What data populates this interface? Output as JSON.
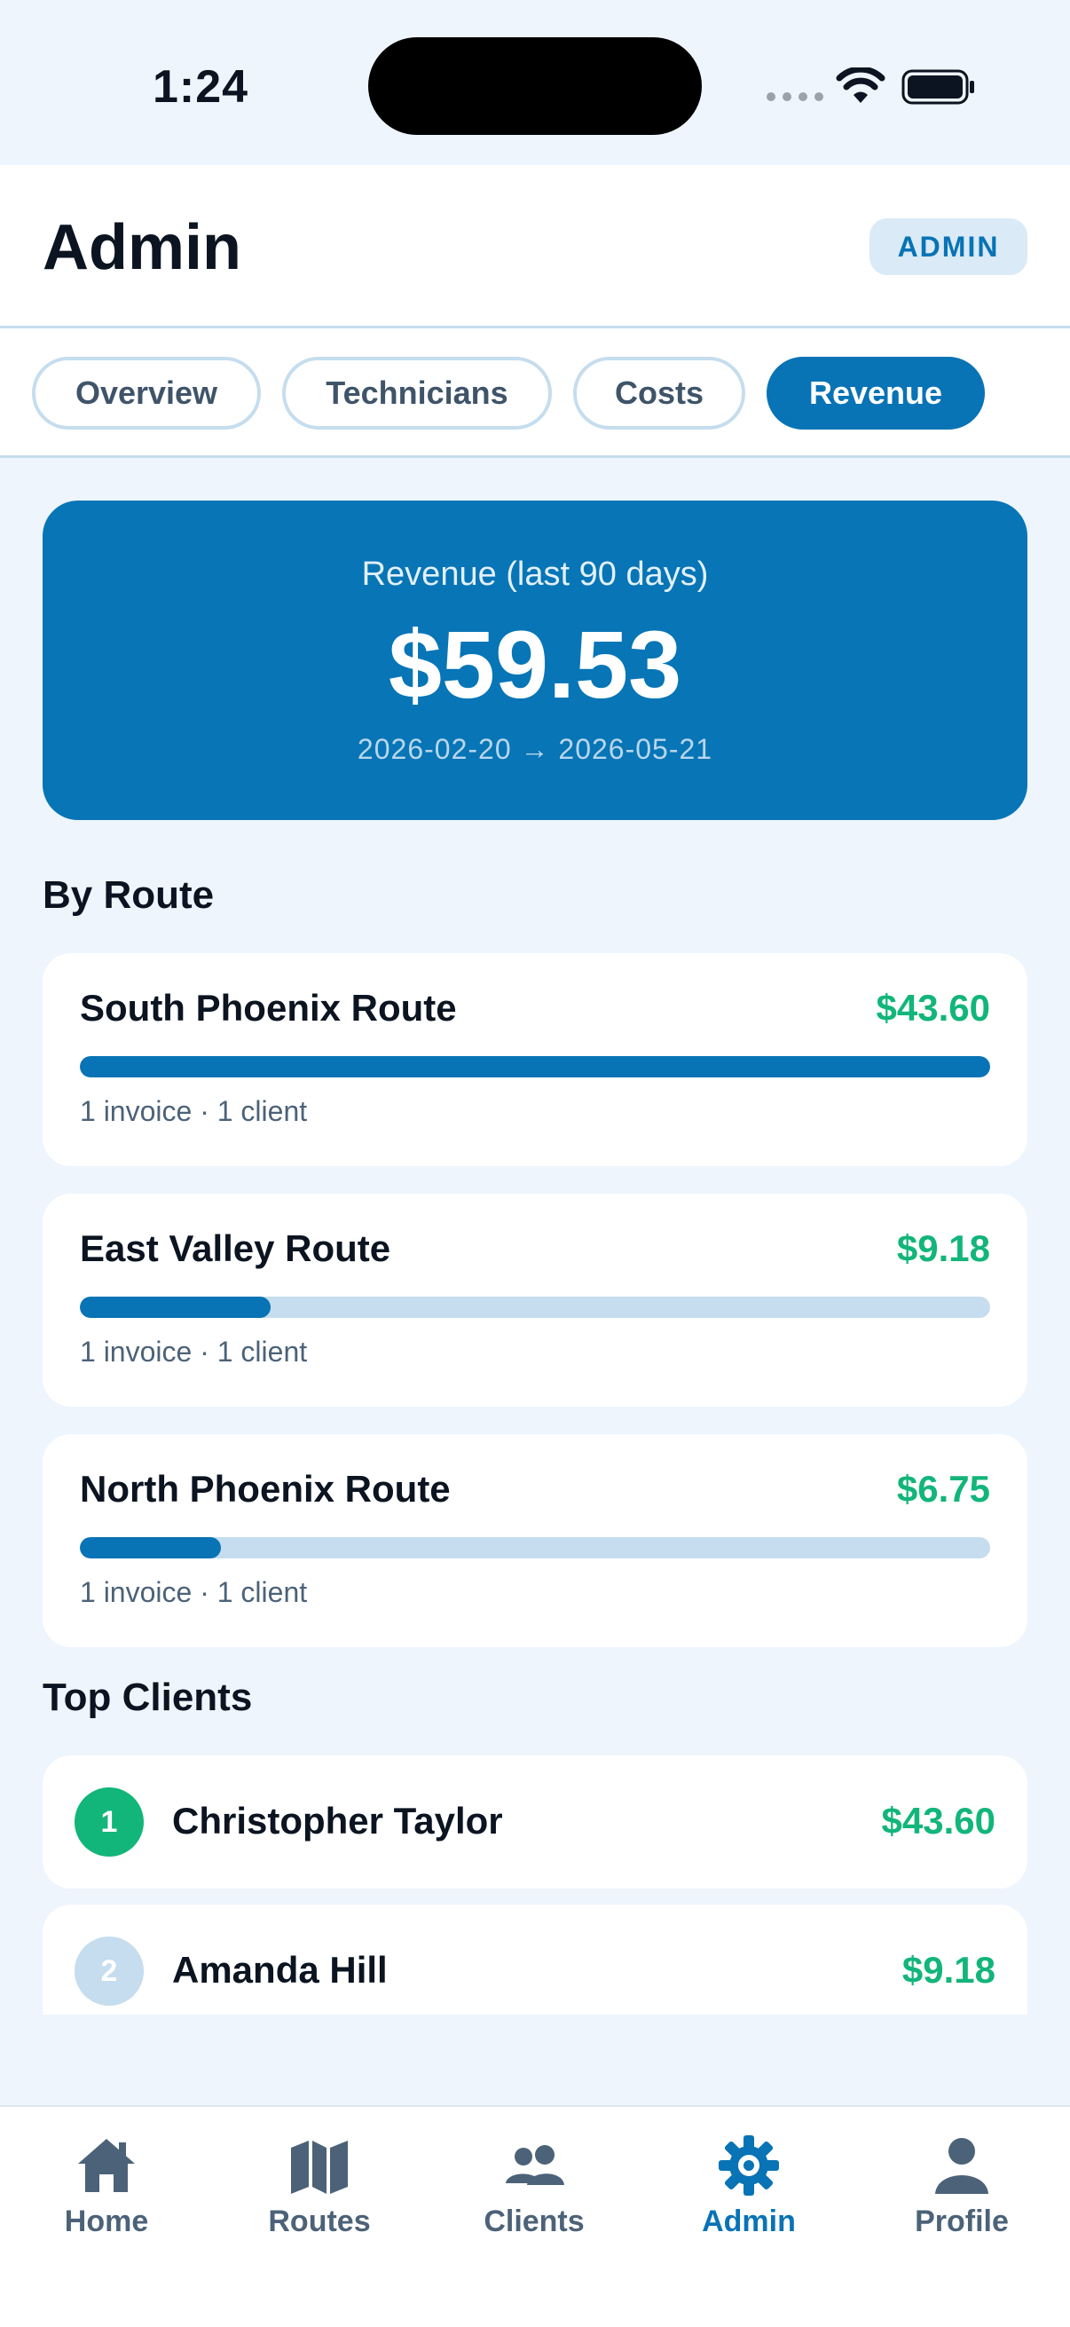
{
  "status_bar": {
    "time": "1:24"
  },
  "header": {
    "title": "Admin",
    "badge": "ADMIN"
  },
  "tabs": [
    {
      "label": "Overview",
      "active": false
    },
    {
      "label": "Technicians",
      "active": false
    },
    {
      "label": "Costs",
      "active": false
    },
    {
      "label": "Revenue",
      "active": true
    }
  ],
  "hero": {
    "label": "Revenue (last 90 days)",
    "amount": "$59.53",
    "range": "2026-02-20 → 2026-05-21"
  },
  "by_route": {
    "title": "By Route",
    "routes": [
      {
        "name": "South Phoenix Route",
        "amount": "$43.60",
        "share": 1.0,
        "meta": "1 invoice · 1 client"
      },
      {
        "name": "East Valley Route",
        "amount": "$9.18",
        "share": 0.21,
        "meta": "1 invoice · 1 client"
      },
      {
        "name": "North Phoenix Route",
        "amount": "$6.75",
        "share": 0.155,
        "meta": "1 invoice · 1 client"
      }
    ]
  },
  "top_clients": {
    "title": "Top Clients",
    "clients": [
      {
        "rank": "1",
        "name": "Christopher Taylor",
        "amount": "$43.60",
        "rank_color": "#12B57A"
      },
      {
        "rank": "2",
        "name": "Amanda Hill",
        "amount": "$9.18",
        "rank_color": "#C5DDEE"
      }
    ]
  },
  "nav": {
    "items": [
      {
        "label": "Home",
        "icon": "home-icon",
        "active": false
      },
      {
        "label": "Routes",
        "icon": "map-icon",
        "active": false
      },
      {
        "label": "Clients",
        "icon": "people-icon",
        "active": false
      },
      {
        "label": "Admin",
        "icon": "gear-icon",
        "active": true
      },
      {
        "label": "Profile",
        "icon": "person-icon",
        "active": false
      }
    ]
  },
  "colors": {
    "primary": "#0873B5",
    "hero": "#0775B6",
    "positive": "#12B57A",
    "background": "#EEF5FD",
    "track": "#C5DDEE"
  }
}
